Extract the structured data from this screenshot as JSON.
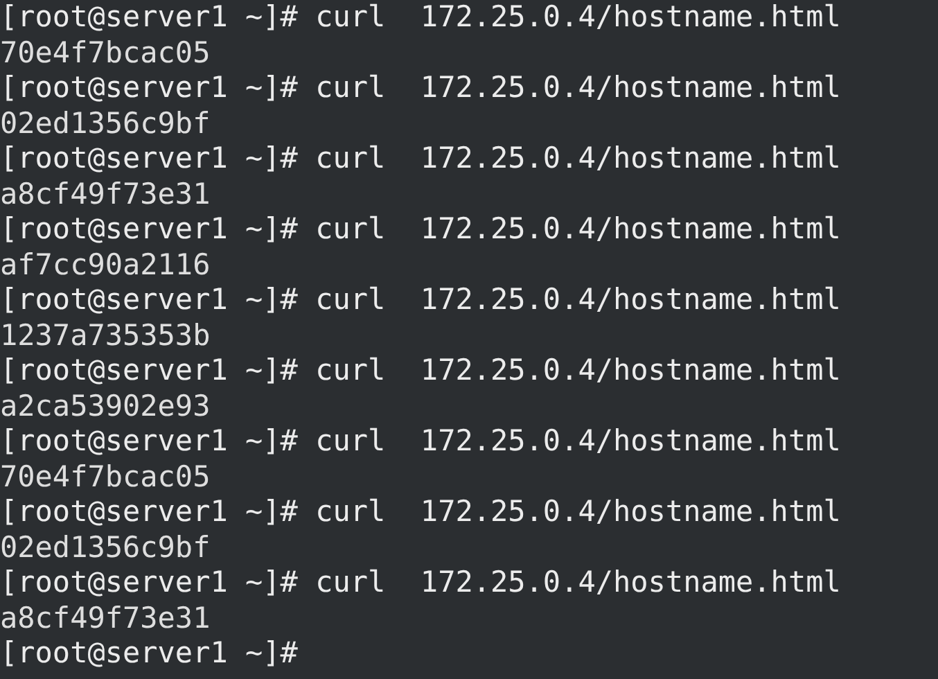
{
  "terminal": {
    "lines": [
      {
        "kind": "command",
        "text": "[root@server1 ~]# curl  172.25.0.4/hostname.html"
      },
      {
        "kind": "output",
        "text": "70e4f7bcac05"
      },
      {
        "kind": "command",
        "text": "[root@server1 ~]# curl  172.25.0.4/hostname.html"
      },
      {
        "kind": "output",
        "text": "02ed1356c9bf"
      },
      {
        "kind": "command",
        "text": "[root@server1 ~]# curl  172.25.0.4/hostname.html"
      },
      {
        "kind": "output",
        "text": "a8cf49f73e31"
      },
      {
        "kind": "command",
        "text": "[root@server1 ~]# curl  172.25.0.4/hostname.html"
      },
      {
        "kind": "output",
        "text": "af7cc90a2116"
      },
      {
        "kind": "command",
        "text": "[root@server1 ~]# curl  172.25.0.4/hostname.html"
      },
      {
        "kind": "output",
        "text": "1237a735353b"
      },
      {
        "kind": "command",
        "text": "[root@server1 ~]# curl  172.25.0.4/hostname.html"
      },
      {
        "kind": "output",
        "text": "a2ca53902e93"
      },
      {
        "kind": "command",
        "text": "[root@server1 ~]# curl  172.25.0.4/hostname.html"
      },
      {
        "kind": "output",
        "text": "70e4f7bcac05"
      },
      {
        "kind": "command",
        "text": "[root@server1 ~]# curl  172.25.0.4/hostname.html"
      },
      {
        "kind": "output",
        "text": "02ed1356c9bf"
      },
      {
        "kind": "command",
        "text": "[root@server1 ~]# curl  172.25.0.4/hostname.html"
      },
      {
        "kind": "output",
        "text": "a8cf49f73e31"
      },
      {
        "kind": "command",
        "text": "[root@server1 ~]#"
      }
    ]
  }
}
